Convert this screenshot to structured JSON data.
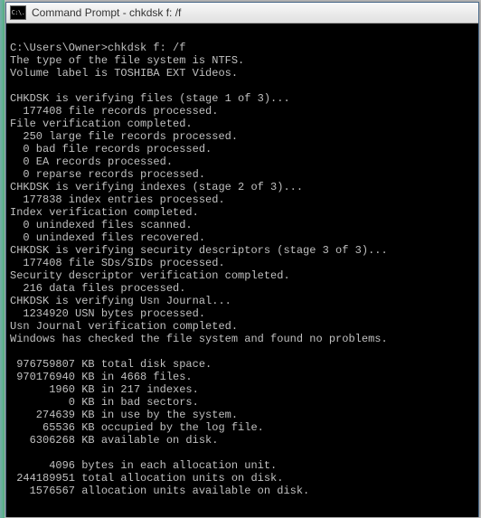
{
  "titlebar": {
    "icon_label": "C:\\.",
    "title": "Command Prompt - chkdsk  f: /f"
  },
  "lines": [
    "",
    "C:\\Users\\Owner>chkdsk f: /f",
    "The type of the file system is NTFS.",
    "Volume label is TOSHIBA EXT Videos.",
    "",
    "CHKDSK is verifying files (stage 1 of 3)...",
    "  177408 file records processed.",
    "File verification completed.",
    "  250 large file records processed.",
    "  0 bad file records processed.",
    "  0 EA records processed.",
    "  0 reparse records processed.",
    "CHKDSK is verifying indexes (stage 2 of 3)...",
    "  177838 index entries processed.",
    "Index verification completed.",
    "  0 unindexed files scanned.",
    "  0 unindexed files recovered.",
    "CHKDSK is verifying security descriptors (stage 3 of 3)...",
    "  177408 file SDs/SIDs processed.",
    "Security descriptor verification completed.",
    "  216 data files processed.",
    "CHKDSK is verifying Usn Journal...",
    "  1234920 USN bytes processed.",
    "Usn Journal verification completed.",
    "Windows has checked the file system and found no problems.",
    "",
    " 976759807 KB total disk space.",
    " 970176940 KB in 4668 files.",
    "      1960 KB in 217 indexes.",
    "         0 KB in bad sectors.",
    "    274639 KB in use by the system.",
    "     65536 KB occupied by the log file.",
    "   6306268 KB available on disk.",
    "",
    "      4096 bytes in each allocation unit.",
    " 244189951 total allocation units on disk.",
    "   1576567 allocation units available on disk."
  ]
}
